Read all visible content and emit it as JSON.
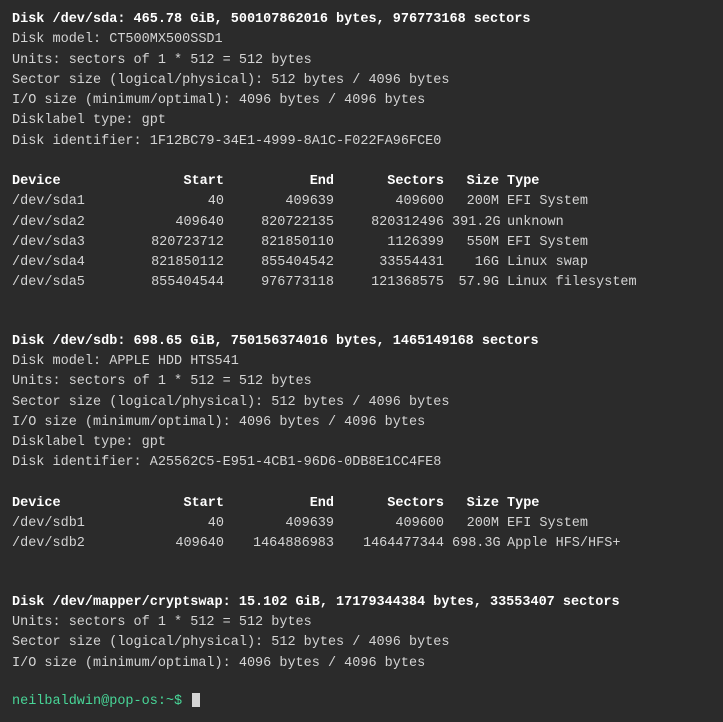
{
  "sda": {
    "header": "Disk /dev/sda: 465.78 GiB, 500107862016 bytes, 976773168 sectors",
    "model": "Disk model: CT500MX500SSD1",
    "units": "Units: sectors of 1 * 512 = 512 bytes",
    "sector_size": "Sector size (logical/physical): 512 bytes / 4096 bytes",
    "io_size": "I/O size (minimum/optimal): 4096 bytes / 4096 bytes",
    "disklabel": "Disklabel type: gpt",
    "identifier": "Disk identifier: 1F12BC79-34E1-4999-8A1C-F022FA96FCE0",
    "table_header": {
      "device": "Device",
      "start": "Start",
      "end": "End",
      "sectors": "Sectors",
      "size": "Size",
      "type": "Type"
    },
    "partitions": [
      {
        "device": "/dev/sda1",
        "start": "40",
        "end": "409639",
        "sectors": "409600",
        "size": "200M",
        "type": "EFI System"
      },
      {
        "device": "/dev/sda2",
        "start": "409640",
        "end": "820722135",
        "sectors": "820312496",
        "size": "391.2G",
        "type": "unknown"
      },
      {
        "device": "/dev/sda3",
        "start": "820723712",
        "end": "821850110",
        "sectors": "1126399",
        "size": "550M",
        "type": "EFI System"
      },
      {
        "device": "/dev/sda4",
        "start": "821850112",
        "end": "855404542",
        "sectors": "33554431",
        "size": "16G",
        "type": "Linux swap"
      },
      {
        "device": "/dev/sda5",
        "start": "855404544",
        "end": "976773118",
        "sectors": "121368575",
        "size": "57.9G",
        "type": "Linux filesystem"
      }
    ]
  },
  "sdb": {
    "header": "Disk /dev/sdb: 698.65 GiB, 750156374016 bytes, 1465149168 sectors",
    "model": "Disk model: APPLE HDD HTS541",
    "units": "Units: sectors of 1 * 512 = 512 bytes",
    "sector_size": "Sector size (logical/physical): 512 bytes / 4096 bytes",
    "io_size": "I/O size (minimum/optimal): 4096 bytes / 4096 bytes",
    "disklabel": "Disklabel type: gpt",
    "identifier": "Disk identifier: A25562C5-E951-4CB1-96D6-0DB8E1CC4FE8",
    "table_header": {
      "device": "Device",
      "start": "Start",
      "end": "End",
      "sectors": "Sectors",
      "size": "Size",
      "type": "Type"
    },
    "partitions": [
      {
        "device": "/dev/sdb1",
        "start": "40",
        "end": "409639",
        "sectors": "409600",
        "size": "200M",
        "type": "EFI System"
      },
      {
        "device": "/dev/sdb2",
        "start": "409640",
        "end": "1464886983",
        "sectors": "1464477344",
        "size": "698.3G",
        "type": "Apple HFS/HFS+"
      }
    ]
  },
  "cryptswap": {
    "header": "Disk /dev/mapper/cryptswap: 15.102 GiB, 17179344384 bytes, 33553407 sectors",
    "units": "Units: sectors of 1 * 512 = 512 bytes",
    "sector_size": "Sector size (logical/physical): 512 bytes / 4096 bytes",
    "io_size": "I/O size (minimum/optimal): 4096 bytes / 4096 bytes"
  },
  "prompt": "neilbaldwin@pop-os:~$"
}
